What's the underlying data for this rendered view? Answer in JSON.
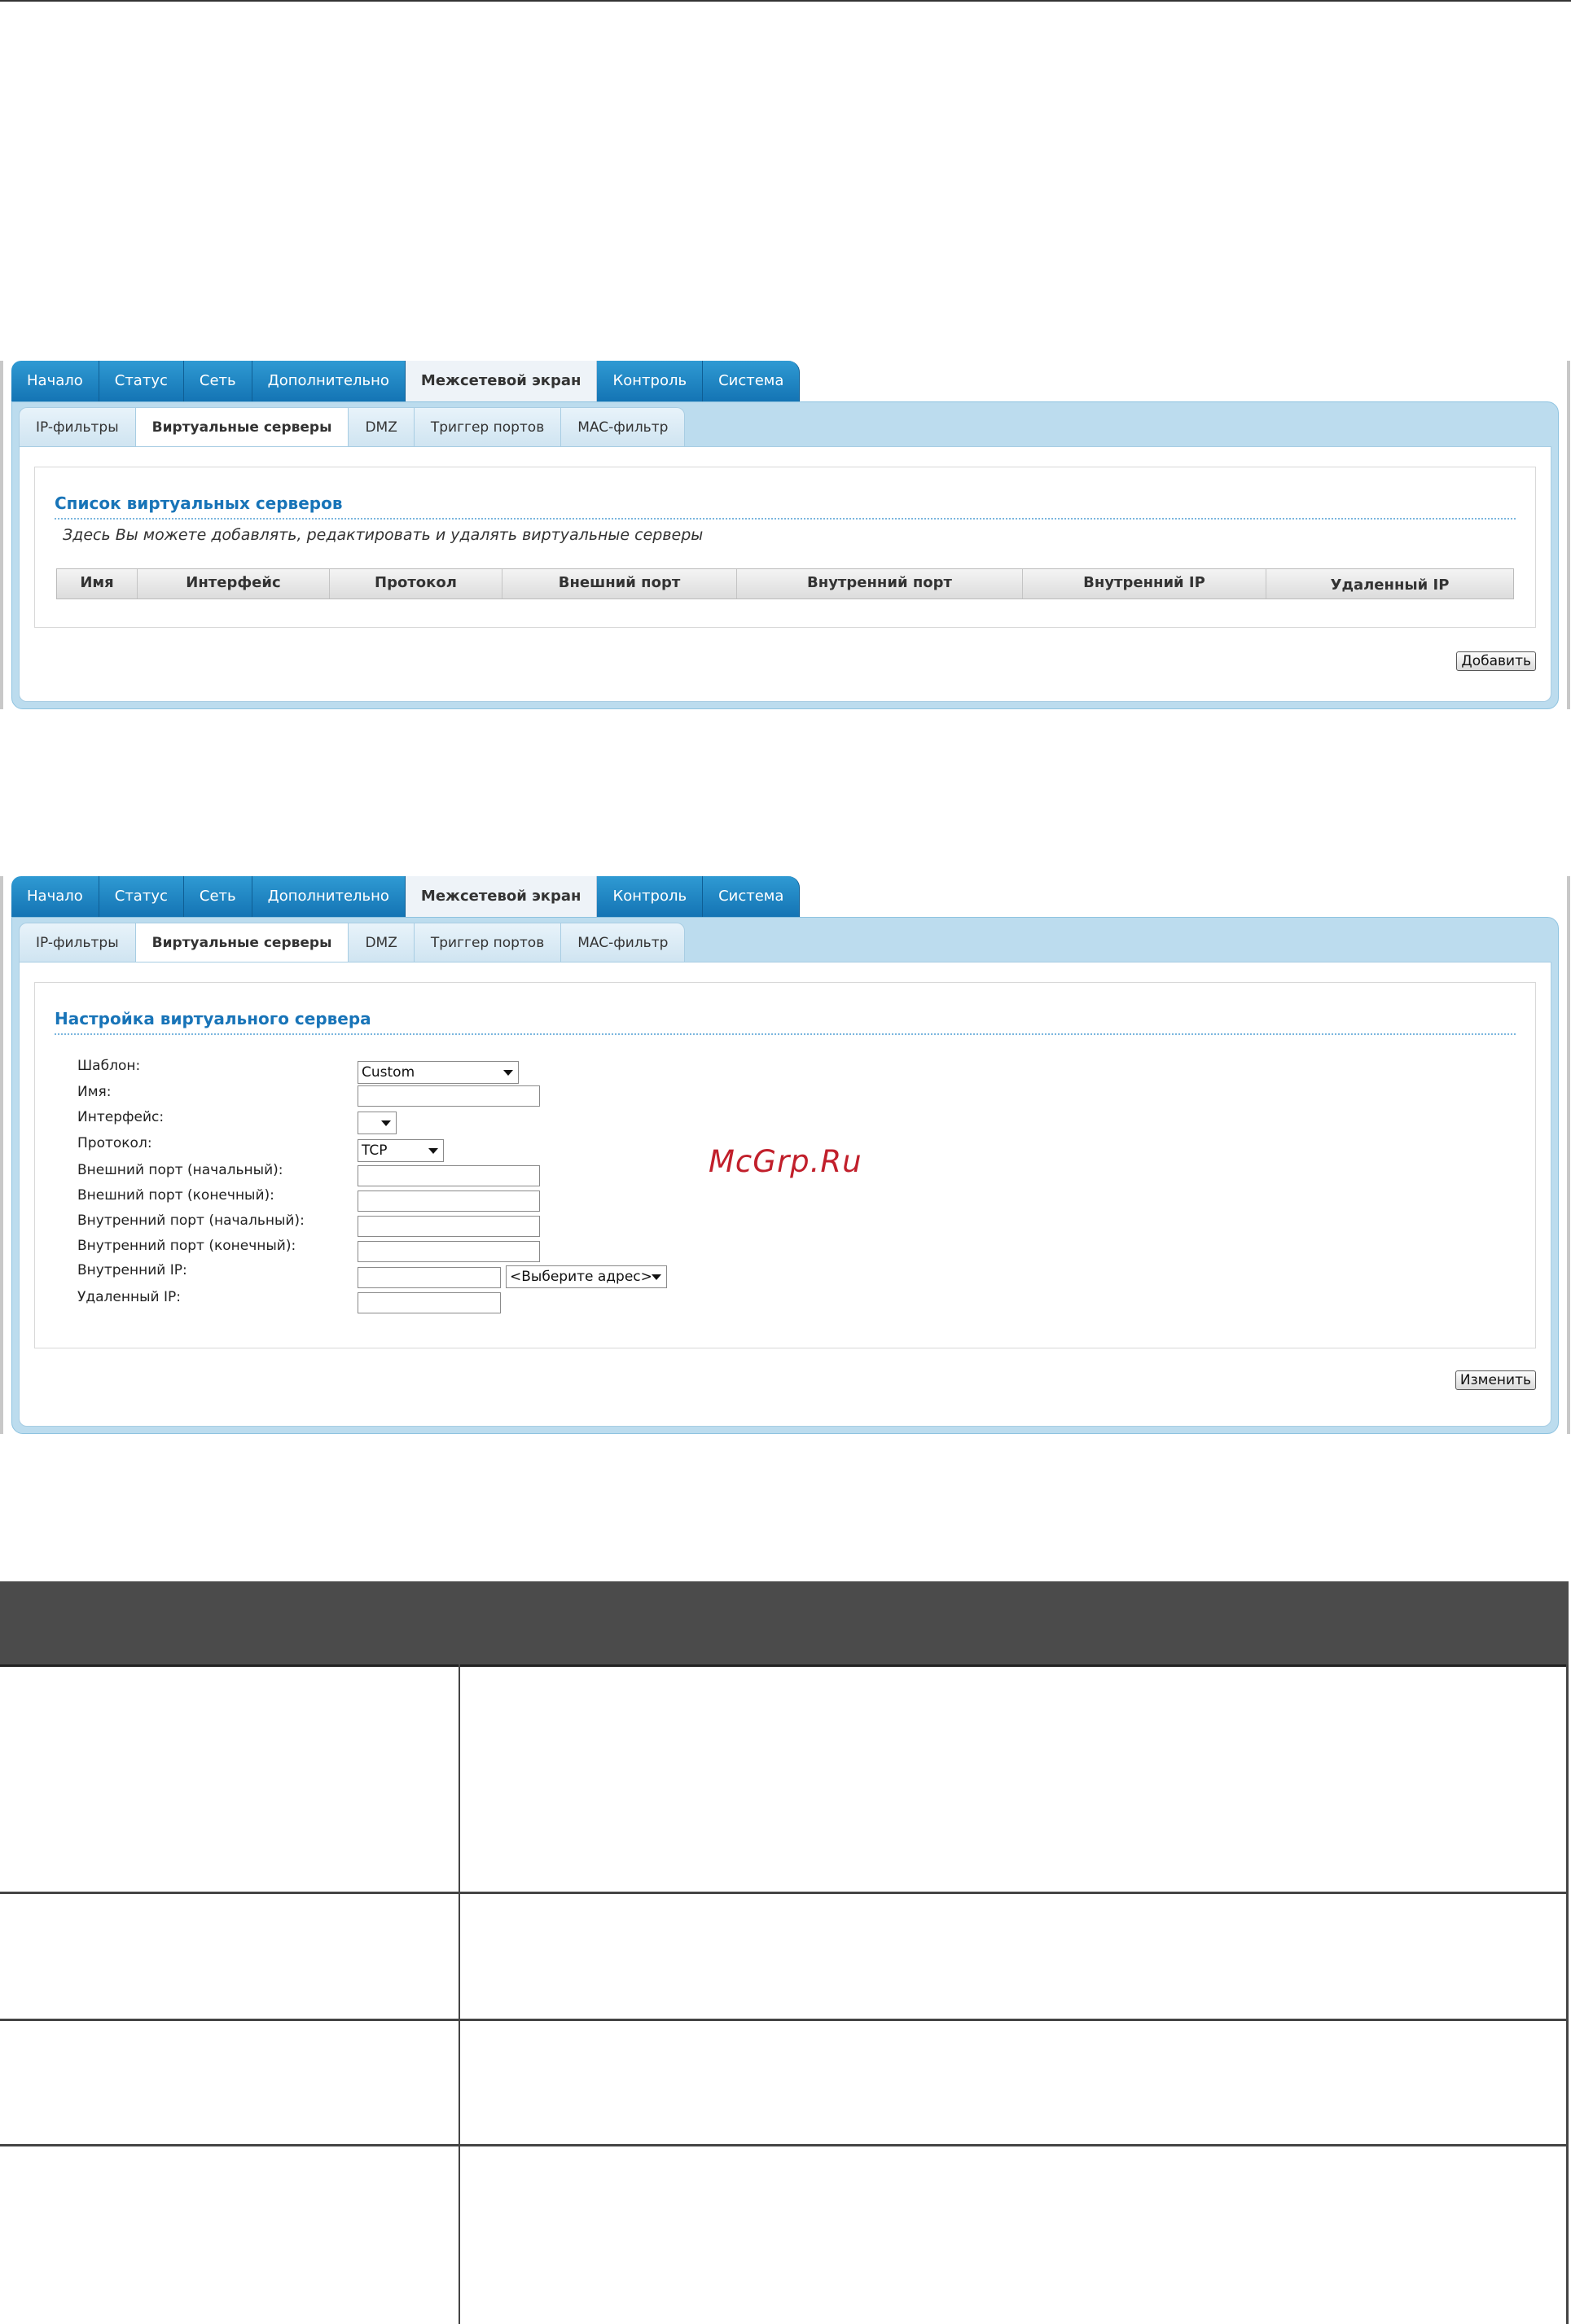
{
  "main_tabs": [
    "Начало",
    "Статус",
    "Сеть",
    "Дополнительно",
    "Межсетевой экран",
    "Контроль",
    "Система"
  ],
  "main_tab_active": "Межсетевой экран",
  "sub_tabs": [
    "IP-фильтры",
    "Виртуальные серверы",
    "DMZ",
    "Триггер портов",
    "MAC-фильтр"
  ],
  "sub_tab_active": "Виртуальные серверы",
  "list_panel": {
    "title": "Список виртуальных серверов",
    "hint": "Здесь Вы можете добавлять, редактировать и удалять виртуальные серверы",
    "columns": [
      "Имя",
      "Интерфейс",
      "Протокол",
      "Внешний порт",
      "Внутренний порт",
      "Внутренний IP",
      "Удаленный IP"
    ],
    "add_button": "Добавить"
  },
  "edit_panel": {
    "title": "Настройка виртуального сервера",
    "labels": {
      "template": "Шаблон:",
      "name": "Имя:",
      "interface": "Интерфейс:",
      "protocol": "Протокол:",
      "ext_port_start": "Внешний порт (начальный):",
      "ext_port_end": "Внешний порт (конечный):",
      "int_port_start": "Внутренний порт (начальный):",
      "int_port_end": "Внутренний порт (конечный):",
      "internal_ip": "Внутренний IP:",
      "remote_ip": "Удаленный IP:"
    },
    "values": {
      "template": "Custom",
      "name": "",
      "interface": "",
      "protocol": "TCP",
      "ext_port_start": "",
      "ext_port_end": "",
      "int_port_start": "",
      "int_port_end": "",
      "internal_ip": "",
      "address_select": "<Выберите адрес>",
      "remote_ip": ""
    },
    "change_button": "Изменить"
  },
  "watermark": "McGrp.Ru",
  "colors": {
    "tab_blue": "#1f86c6",
    "frame_blue": "#bcdcee",
    "title_blue": "#1874b8",
    "watermark_red": "#c11f2b",
    "table_header": "#4b4b4b"
  }
}
